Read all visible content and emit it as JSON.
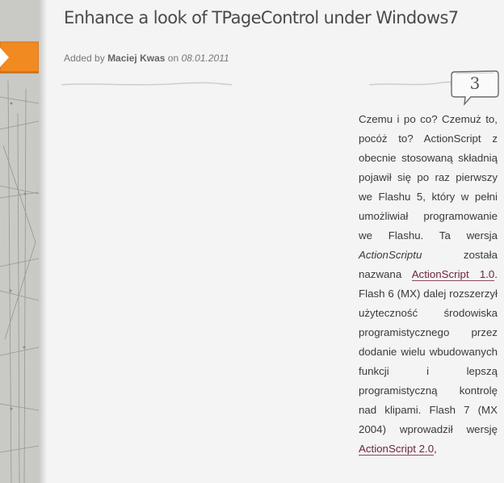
{
  "post": {
    "title": "Enhance a look of TPageControl under Windows7",
    "meta_prefix": "Added by",
    "author": "Maciej Kwas",
    "meta_on": "on",
    "date": "08.01.2011",
    "comment_count": "3"
  },
  "article": {
    "p1": "Czemu i po co? Czemuż to, pocóż to? ActionScript z obecnie stosowaną składnią pojawił się po raz pierwszy we Flashu 5, który w pełni umożliwiał programowanie we Flashu. Ta wersja ",
    "p1_em": "ActionScriptu",
    "p2": " została nazwana ",
    "link1": "ActionScript 1.0",
    "p3": ". Flash 6 (MX) dalej rozszerzył użyteczność środowiska programistycznego przez dodanie wielu wbudowanych funkcji i lepszą programistyczną kontrolę nad klipami. Flash 7 (MX 2004) wprowadził wersję ",
    "link2": "ActionScript 2.0",
    "p4": ","
  },
  "colors": {
    "ribbon": "#f28a22",
    "link": "#6b2740",
    "title": "#4a4a4a"
  },
  "icons": {
    "ribbon": "orange-ribbon-arrow-icon",
    "bubble": "speech-bubble-icon"
  }
}
